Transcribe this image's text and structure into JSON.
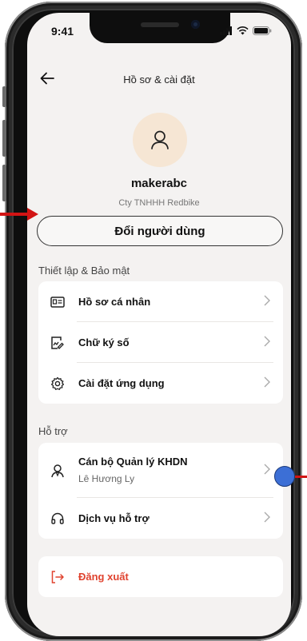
{
  "status_bar": {
    "time": "9:41"
  },
  "header": {
    "back_icon": "arrow-left-icon",
    "title": "Hồ sơ & cài đặt"
  },
  "profile": {
    "avatar_icon": "user-icon",
    "username": "makerabc",
    "company": "Cty TNHHH Redbike"
  },
  "switch_user": {
    "label": "Đổi người dùng"
  },
  "security_section": {
    "title": "Thiết lập & Bảo mật",
    "items": [
      {
        "label": "Hồ sơ cá nhân",
        "icon": "id-card-icon"
      },
      {
        "label": "Chữ ký số",
        "icon": "signature-icon"
      },
      {
        "label": "Cài đặt ứng dụng",
        "icon": "gear-icon"
      }
    ]
  },
  "support_section": {
    "title": "Hỗ trợ",
    "items": [
      {
        "label": "Cán bộ Quản lý KHDN",
        "sublabel": "Lê Hương Ly",
        "icon": "user-manager-icon"
      },
      {
        "label": "Dịch vụ hỗ trợ",
        "icon": "headset-icon"
      }
    ]
  },
  "logout": {
    "label": "Đăng xuất",
    "icon": "logout-icon"
  },
  "colors": {
    "accent_red": "#e0432f",
    "avatar_bg": "#f6e6d4",
    "screen_bg": "#f4f2f1",
    "annotation_red": "#d21414",
    "annotation_blue": "#3c6fd6"
  }
}
